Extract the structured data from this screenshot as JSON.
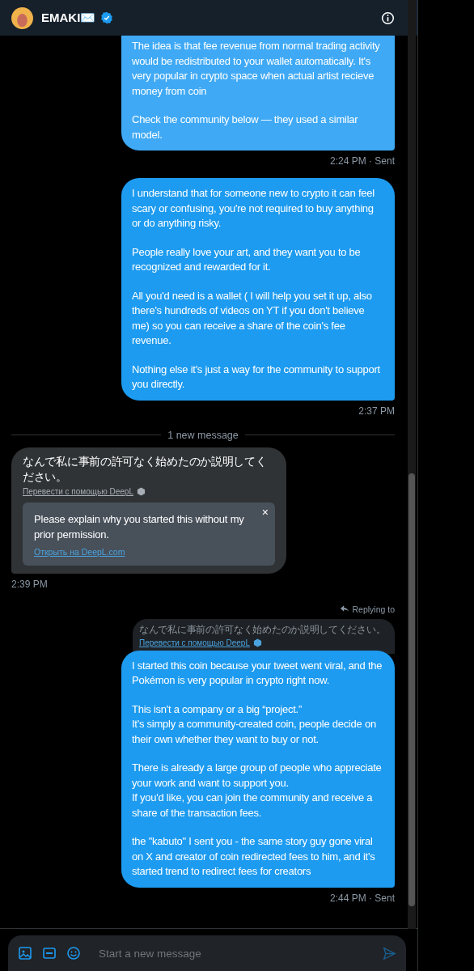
{
  "header": {
    "name": "EMAKI✉️",
    "verified": true
  },
  "messages": [
    {
      "kind": "outgoing",
      "paragraphs": [
        "The idea is that fee revenue from normal trading activity would be redistributed to your wallet automatically. It's very popular in crypto space when actual artist recieve money from coin",
        "Check the community below — they used a similar model."
      ],
      "time": "2:24 PM · Sent"
    },
    {
      "kind": "outgoing",
      "paragraphs": [
        "I understand that for someone new to crypto it can feel scary or confusing, you're not required to buy anything or do anything risky.",
        "People really love your art, and they want you to be recognized and rewarded for it.",
        "All you'd need is a wallet ( I will help you set it up, also there's hundreds of videos on YT if you don't believe me)  so you can receive a share of the coin's fee revenue.",
        "Nothing else it's just a way for the community to support you directly."
      ],
      "time": "2:37 PM"
    },
    {
      "kind": "divider",
      "text": "1 new message"
    },
    {
      "kind": "incoming",
      "text": "なんで私に事前の許可なく始めたのか説明してください。",
      "translate_link": "Перевести с помощью DeepL",
      "translation": "Please explain why you started this without my prior permission.",
      "open_link": "Открыть на DeepL.com",
      "close": "×",
      "time": "2:39 PM"
    },
    {
      "kind": "reply",
      "replying": "Replying to",
      "quote": "なんで私に事前の許可なく始めたのか説明してください。",
      "quote_link": "Перевести с помощью DeepL",
      "paragraphs": [
        "I started this coin because your tweet went viral, and the Pokémon is very popular in crypto right now.",
        "This isn't a company or a big “project.”\nIt's simply a community-created coin, people decide on their own whether they want to buy or not.",
        "There is already a large group of people who appreciate your work and want to support you.\nIf you'd like, you can join the community and receive a share of the transaction fees.",
        "the \"kabuto\" I sent you - the same story guy gone viral on X and creator of coin redirected fees to him, and it's started trend to redirect fees for creators"
      ],
      "time": "2:44 PM · Sent"
    }
  ],
  "composer": {
    "placeholder": "Start a new message"
  }
}
